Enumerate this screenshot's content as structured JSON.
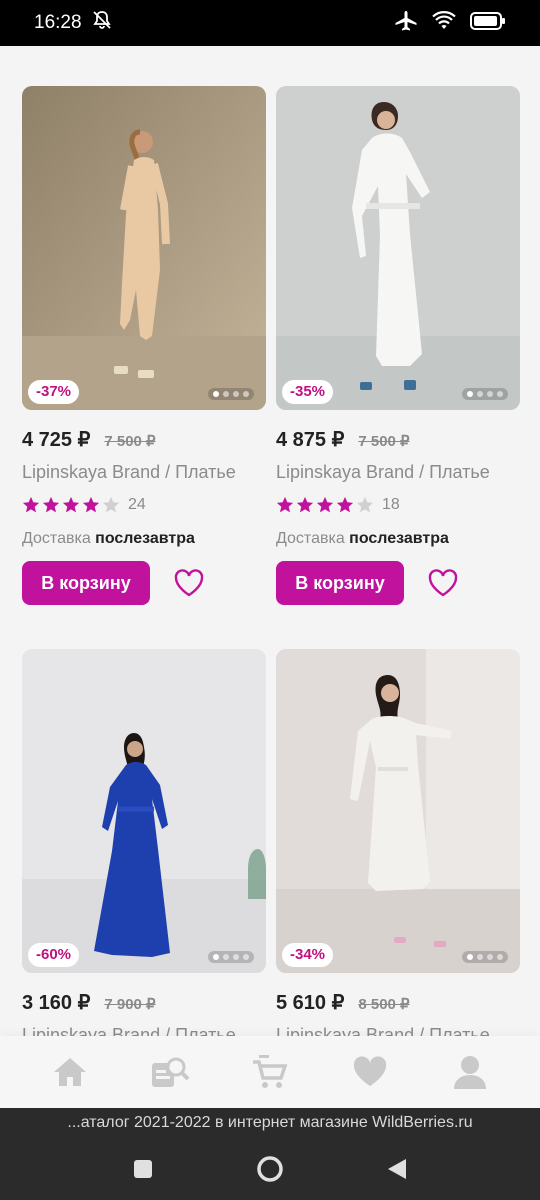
{
  "status_bar": {
    "time": "16:28",
    "icons": [
      "mute-bell-icon",
      "airplane-icon",
      "wifi-icon",
      "battery-icon"
    ]
  },
  "products": [
    {
      "price": "4 725 ₽",
      "old_price": "7 500 ₽",
      "discount": "-37%",
      "title": "Lipinskaya Brand / Платье",
      "rating_stars": 4,
      "rating_count": "24",
      "delivery_label": "Доставка",
      "delivery_value": "послезавтра",
      "cart_label": "В корзину"
    },
    {
      "price": "4 875 ₽",
      "old_price": "7 500 ₽",
      "discount": "-35%",
      "title": "Lipinskaya Brand / Платье",
      "rating_stars": 4,
      "rating_count": "18",
      "delivery_label": "Доставка",
      "delivery_value": "послезавтра",
      "cart_label": "В корзину"
    },
    {
      "price": "3 160 ₽",
      "old_price": "7 900 ₽",
      "discount": "-60%",
      "title": "Lipinskaya Brand / Платье"
    },
    {
      "price": "5 610 ₽",
      "old_price": "8 500 ₽",
      "discount": "-34%",
      "title": "Lipinskaya Brand / Платье"
    }
  ],
  "tabbar": {
    "items": [
      "home-icon",
      "catalog-search-icon",
      "cart-icon",
      "favorites-icon",
      "profile-icon"
    ]
  },
  "browser": {
    "url_text": "...аталог 2021-2022 в интернет магазине WildBerries.ru"
  },
  "colors": {
    "accent": "#c0129c",
    "discount_text": "#c0127f",
    "text_dark": "#222222",
    "text_muted": "#8b8b8b"
  }
}
